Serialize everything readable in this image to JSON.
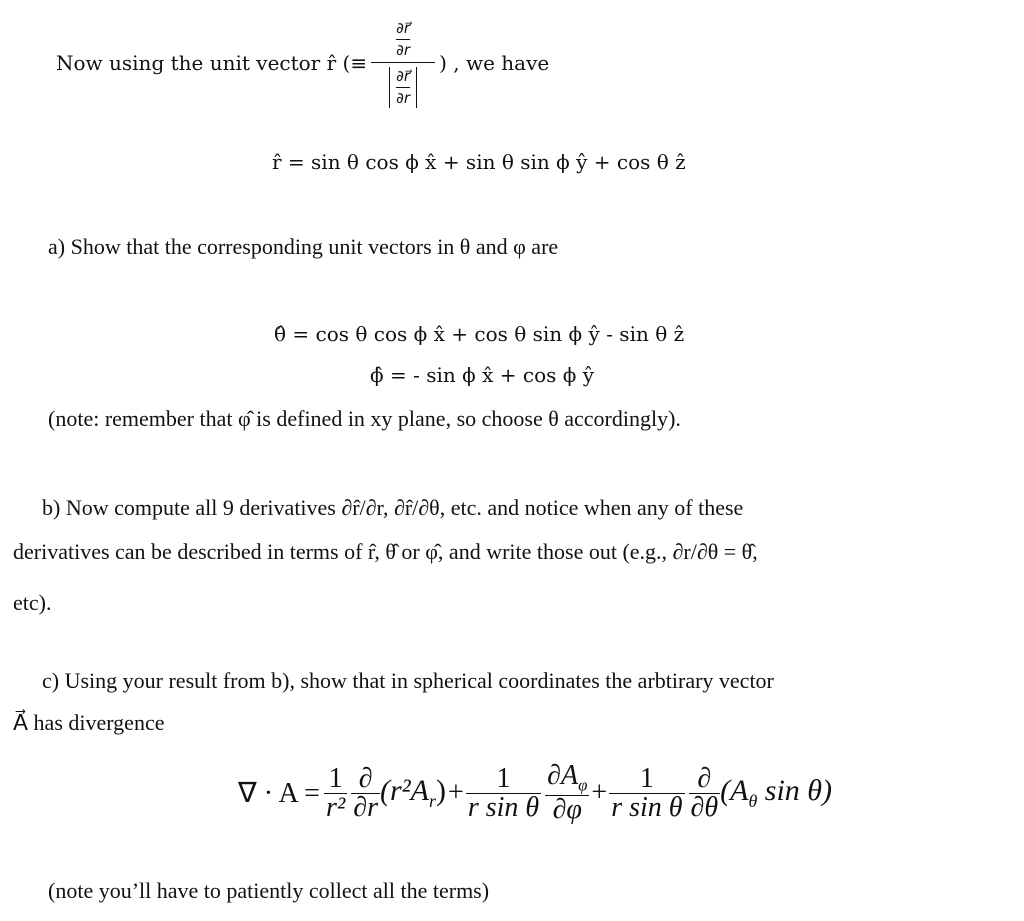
{
  "intro": {
    "lead": "Now using the unit vector r̂ (≡",
    "frac_num_num": "∂r⃗",
    "frac_num_den": "∂r",
    "frac_den_num": "∂r⃗",
    "frac_den_den": "∂r",
    "tail": ") , we have"
  },
  "eq_rhat": "r̂ = sin θ cos ϕ x̂ + sin θ sin ϕ ŷ + cos θ ẑ",
  "part_a": {
    "prompt": "a) Show that the corresponding unit vectors in θ and φ are",
    "eq_theta": "θ̂ = cos θ cos ϕ x̂ + cos θ sin ϕ ŷ - sin θ ẑ",
    "eq_phi": "ϕ̂  = - sin ϕ x̂ + cos ϕ ŷ",
    "note": "(note: remember that φ̂ is defined in xy plane, so choose θ accordingly)."
  },
  "part_b": {
    "line1": "b) Now compute all 9 derivatives ∂r̂/∂r, ∂r̂/∂θ, etc. and notice when any of these",
    "line2": "derivatives can be described in terms of r̂, θ̂ or φ̂, and write those out (e.g., ∂r/∂θ = θ̂,",
    "line3": "etc)."
  },
  "part_c": {
    "line1": "c) Using your result from b), show that in spherical coordinates the arbtirary vector",
    "line2": "A⃗ has divergence",
    "formula": {
      "lhs": "∇ · A =",
      "t1_coef_num": "1",
      "t1_coef_den": "r²",
      "t1_op_num": "∂",
      "t1_op_den": "∂r",
      "t1_arg": "(r²A",
      "t1_arg_sub": "r",
      "t1_close": ")",
      "plus1": "+",
      "t2_coef_num": "1",
      "t2_coef_den": "r sin θ",
      "t2_op_num": "∂A",
      "t2_op_num_sub": "φ",
      "t2_op_den": "∂φ",
      "plus2": "+",
      "t3_coef_num": "1",
      "t3_coef_den": "r sin θ",
      "t3_op_num": "∂",
      "t3_op_den": "∂θ",
      "t3_arg": "(A",
      "t3_arg_sub": "θ",
      "t3_arg_tail": " sin θ)"
    },
    "note": "(note you’ll have to patiently collect all the terms)"
  }
}
